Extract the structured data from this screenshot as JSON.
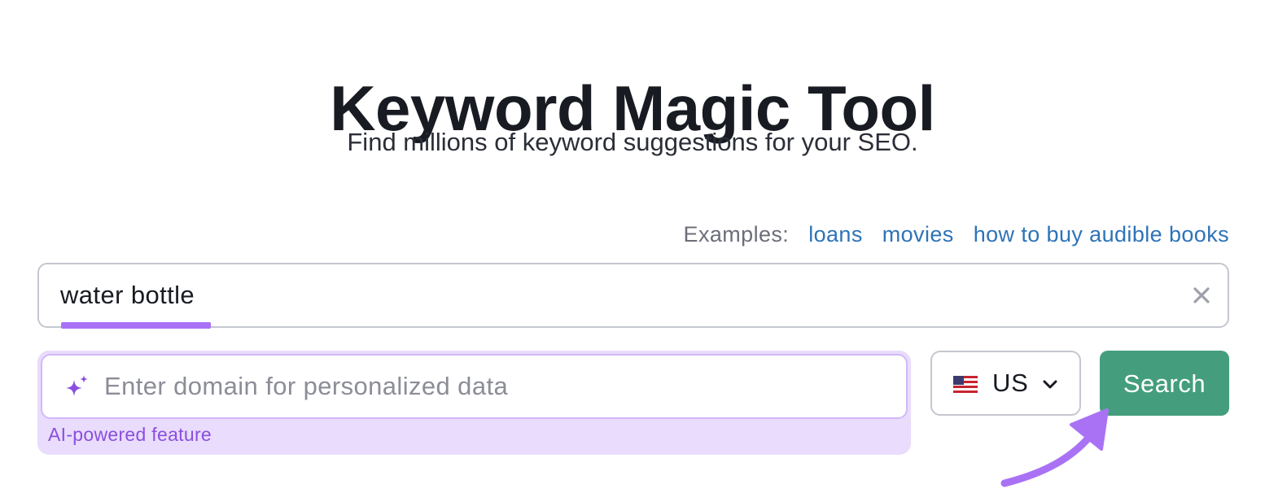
{
  "header": {
    "title": "Keyword Magic Tool",
    "subtitle": "Find millions of keyword suggestions for your SEO."
  },
  "examples": {
    "label": "Examples:",
    "links": [
      "loans",
      "movies",
      "how to buy audible books"
    ]
  },
  "keyword_input": {
    "value": "water bottle",
    "clear_icon": "close-icon"
  },
  "domain_input": {
    "placeholder": "Enter domain for personalized data",
    "icon": "sparkle-icon",
    "feature_label": "AI-powered feature"
  },
  "country_select": {
    "selected": "US",
    "flag": "us-flag-icon",
    "chevron": "chevron-down-icon"
  },
  "search_button": {
    "label": "Search"
  },
  "colors": {
    "accent_purple": "#a972f5",
    "ai_background": "#e9dcfc",
    "search_green": "#449e7d",
    "link_blue": "#2e73b8"
  }
}
